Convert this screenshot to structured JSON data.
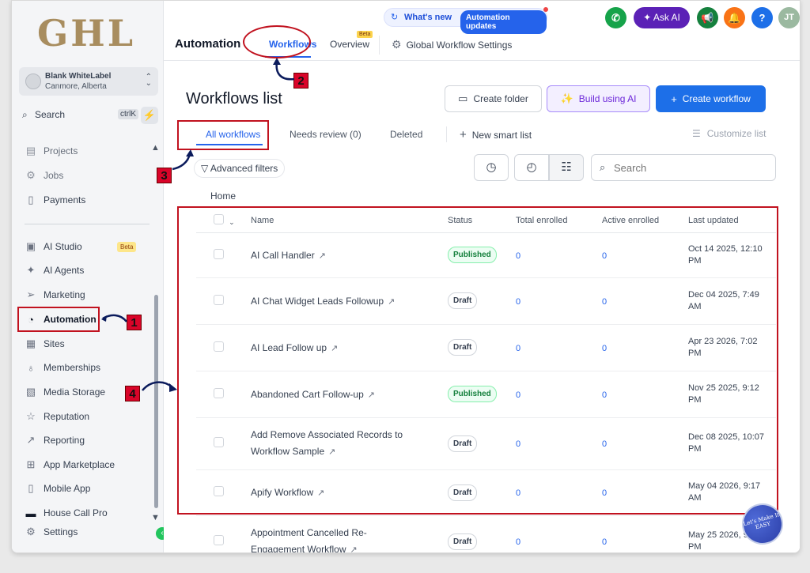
{
  "brand": {
    "logo": "GHL"
  },
  "account": {
    "name": "Blank WhiteLabel",
    "location": "Canmore, Alberta"
  },
  "sidebar": {
    "search_label": "Search",
    "search_shortcut": "ctrlK",
    "items": [
      {
        "label": "Projects",
        "icon": "projects-icon"
      },
      {
        "label": "Jobs",
        "icon": "jobs-icon"
      },
      {
        "label": "Payments",
        "icon": "payments-icon"
      },
      {
        "label": "AI Studio",
        "icon": "ai-studio-icon",
        "badge": "Beta"
      },
      {
        "label": "AI Agents",
        "icon": "sparkle-icon"
      },
      {
        "label": "Marketing",
        "icon": "send-icon"
      },
      {
        "label": "Automation",
        "icon": "automation-icon",
        "active": true
      },
      {
        "label": "Sites",
        "icon": "sites-icon"
      },
      {
        "label": "Memberships",
        "icon": "award-icon"
      },
      {
        "label": "Media Storage",
        "icon": "image-icon"
      },
      {
        "label": "Reputation",
        "icon": "star-icon"
      },
      {
        "label": "Reporting",
        "icon": "trend-icon"
      },
      {
        "label": "App Marketplace",
        "icon": "grid-icon"
      },
      {
        "label": "Mobile App",
        "icon": "phone-icon"
      },
      {
        "label": "House Call Pro",
        "icon": "toolbox-icon"
      },
      {
        "label": "Settings",
        "icon": "gear-icon"
      }
    ]
  },
  "header": {
    "whats_new": "What's new",
    "automation_updates": "Automation updates",
    "ask_ai": "Ask AI",
    "help": "?",
    "avatar_initials": "JT",
    "page_title": "Automation",
    "tabs": [
      {
        "label": "Workflows",
        "active": true
      },
      {
        "label": "Overview",
        "badge": "Beta"
      }
    ],
    "global_settings": "Global Workflow Settings"
  },
  "main": {
    "title": "Workflows list",
    "buttons": {
      "create_folder": "Create folder",
      "build_ai": "Build using AI",
      "create_workflow": "Create workflow"
    },
    "subtabs": [
      "All workflows",
      "Needs review (0)",
      "Deleted"
    ],
    "new_smart_list": "New smart list",
    "customize_list": "Customize list",
    "advanced_filters": "Advanced filters",
    "search_placeholder": "Search",
    "breadcrumb": "Home",
    "columns": [
      "Name",
      "Status",
      "Total enrolled",
      "Active enrolled",
      "Last updated"
    ],
    "rows": [
      {
        "name": "AI Call Handler",
        "status": "Published",
        "total": "0",
        "active": "0",
        "updated_1": "Oct 14 2025, 12:10",
        "updated_2": "PM"
      },
      {
        "name": "AI Chat Widget Leads Followup",
        "status": "Draft",
        "total": "0",
        "active": "0",
        "updated_1": "Dec 04 2025, 7:49",
        "updated_2": "AM"
      },
      {
        "name": "AI Lead Follow up",
        "status": "Draft",
        "total": "0",
        "active": "0",
        "updated_1": "Apr 23 2026, 7:02",
        "updated_2": "PM"
      },
      {
        "name": "Abandoned Cart Follow-up",
        "status": "Published",
        "total": "0",
        "active": "0",
        "updated_1": "Nov 25 2025, 9:12",
        "updated_2": "PM"
      },
      {
        "name": "Add Remove Associated Records to Workflow Sample",
        "status": "Draft",
        "total": "0",
        "active": "0",
        "updated_1": "Dec 08 2025, 10:07",
        "updated_2": "PM"
      },
      {
        "name": "Apify Workflow",
        "status": "Draft",
        "total": "0",
        "active": "0",
        "updated_1": "May 04 2026, 9:17",
        "updated_2": "AM"
      },
      {
        "name": "Appointment Cancelled Re-Engagement Workflow",
        "status": "Draft",
        "total": "0",
        "active": "0",
        "updated_1": "May 25 2026, 9:3",
        "updated_2": "PM"
      }
    ]
  },
  "annotations": {
    "n1": "1",
    "n2": "2",
    "n3": "3",
    "n4": "4"
  },
  "watermark": "Let's Make It EASY",
  "colors": {
    "primary": "#1d6fe8",
    "annotation": "#c1121f",
    "published": "#15803d",
    "ai_purple": "#5b21b6"
  }
}
